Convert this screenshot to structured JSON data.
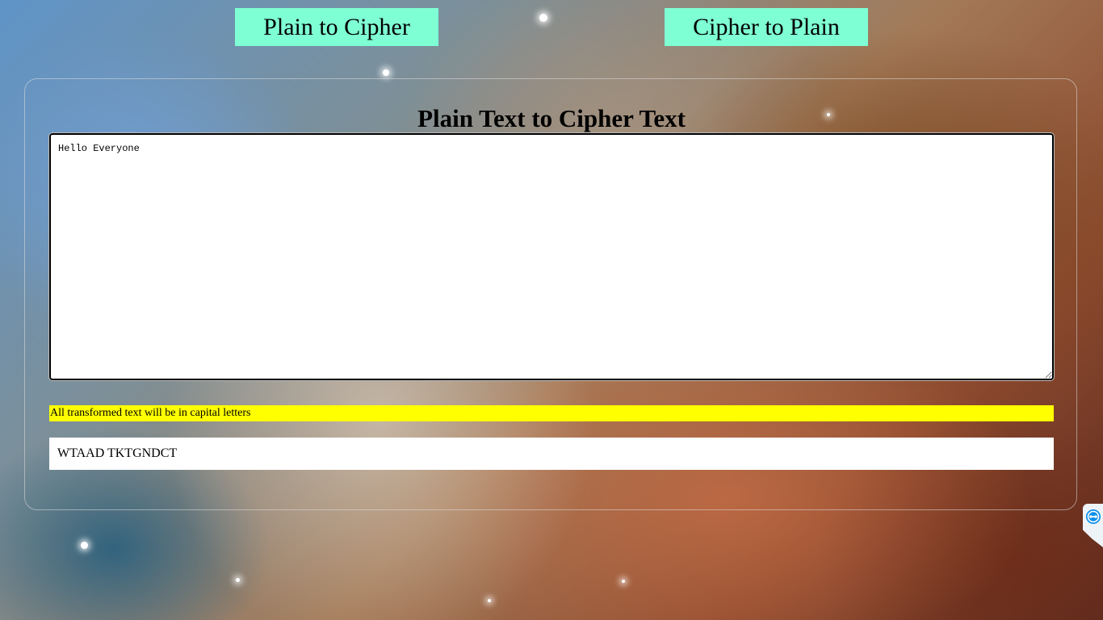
{
  "nav": {
    "plain_to_cipher_label": "Plain to Cipher",
    "cipher_to_plain_label": "Cipher to Plain"
  },
  "panel": {
    "title": "Plain Text to Cipher Text",
    "input_value": "Hello Everyone",
    "note": "All transformed text will be in capital letters",
    "output": "WTAAD TKTGNDCT"
  },
  "side_widget": {
    "icon": "teamviewer-icon"
  },
  "colors": {
    "nav_button_bg": "#7fffd4",
    "note_bg": "#ffff00"
  }
}
